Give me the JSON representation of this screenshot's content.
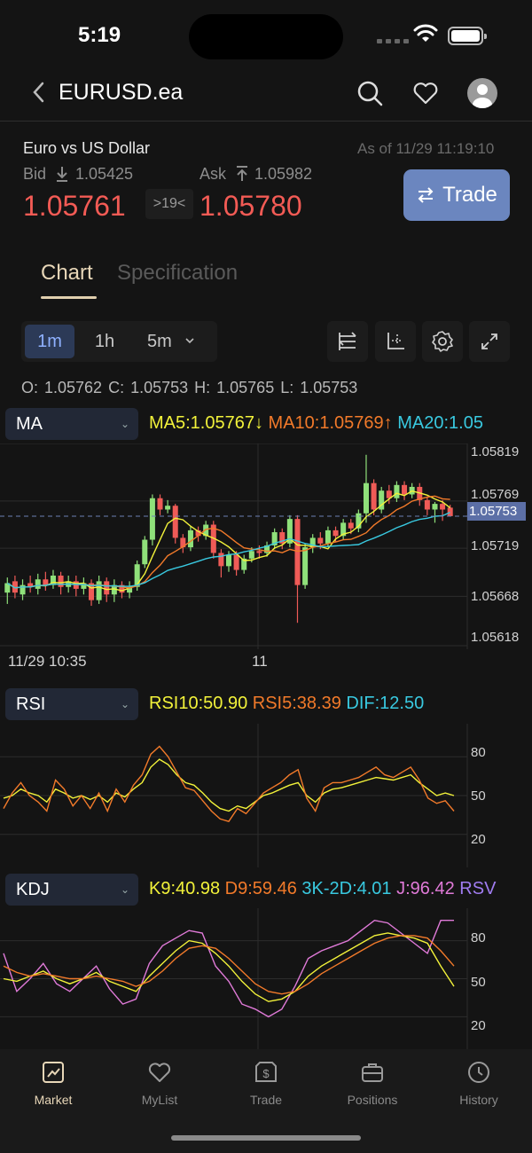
{
  "status": {
    "time": "5:19"
  },
  "header": {
    "symbol": "EURUSD.ea"
  },
  "quote": {
    "name": "Euro vs US Dollar",
    "as_of": "As of 11/29 11:19:10",
    "bid_label": "Bid",
    "bid_low": "1.05425",
    "ask_label": "Ask",
    "ask_high": "1.05982",
    "bid_price": "1.05761",
    "spread": ">19<",
    "ask_price": "1.05780",
    "trade_button": "Trade"
  },
  "tabs": [
    "Chart",
    "Specification"
  ],
  "intervals": [
    "1m",
    "1h",
    "5m"
  ],
  "ohlc": "O: 1.05762  C: 1.05753  H: 1.05765  L: 1.05753",
  "ma": {
    "selector": "MA",
    "ma5": "MA5:1.05767↓",
    "ma10": "MA10:1.05769↑",
    "ma20": "MA20:1.05",
    "colors": {
      "ma5": "#f2f23a",
      "ma10": "#f27a2a",
      "ma20": "#39c9e0"
    }
  },
  "price_axis": [
    "1.05819",
    "1.05769",
    "1.05719",
    "1.05668",
    "1.05618"
  ],
  "current_price": "1.05753",
  "time_axis": [
    "11/29 10:35",
    "11"
  ],
  "rsi": {
    "selector": "RSI",
    "rsi10": "RSI10:50.90",
    "rsi5": "RSI5:38.39",
    "dif": "DIF:12.50",
    "axis": [
      "80",
      "50",
      "20"
    ]
  },
  "kdj": {
    "selector": "KDJ",
    "k": "K9:40.98",
    "d": "D9:59.46",
    "diff": "3K-2D:4.01",
    "j": "J:96.42",
    "rsv": "RSV",
    "axis": [
      "80",
      "50",
      "20"
    ]
  },
  "nav": [
    {
      "label": "Market",
      "icon": "chart-trend-icon",
      "active": true
    },
    {
      "label": "MyList",
      "icon": "heart-icon",
      "active": false
    },
    {
      "label": "Trade",
      "icon": "dollar-swap-icon",
      "active": false
    },
    {
      "label": "Positions",
      "icon": "briefcase-icon",
      "active": false
    },
    {
      "label": "History",
      "icon": "clock-history-icon",
      "active": false
    }
  ],
  "chart_data": {
    "type": "candlestick",
    "x_labels": [
      "11/29 10:35",
      "11"
    ],
    "y_ticks": [
      1.05819,
      1.05769,
      1.05719,
      1.05668,
      1.05618
    ],
    "last": 1.05753,
    "candles": [
      [
        1.05672,
        1.05682,
        1.0566,
        1.05688
      ],
      [
        1.05684,
        1.05672,
        1.05666,
        1.0569
      ],
      [
        1.0567,
        1.0568,
        1.05664,
        1.05686
      ],
      [
        1.05682,
        1.05678,
        1.05672,
        1.0569
      ],
      [
        1.05676,
        1.05686,
        1.0567,
        1.05692
      ],
      [
        1.05686,
        1.0568,
        1.05674,
        1.05694
      ],
      [
        1.0568,
        1.0569,
        1.05676,
        1.05696
      ],
      [
        1.0569,
        1.05678,
        1.0567,
        1.05694
      ],
      [
        1.05678,
        1.05684,
        1.05672,
        1.0569
      ],
      [
        1.05684,
        1.05676,
        1.05668,
        1.0569
      ],
      [
        1.05676,
        1.05682,
        1.0567,
        1.05688
      ],
      [
        1.05682,
        1.05664,
        1.05658,
        1.05686
      ],
      [
        1.05664,
        1.05684,
        1.0566,
        1.0569
      ],
      [
        1.05684,
        1.0567,
        1.05662,
        1.05688
      ],
      [
        1.0567,
        1.0568,
        1.05662,
        1.05686
      ],
      [
        1.0568,
        1.05672,
        1.05666,
        1.05684
      ],
      [
        1.05672,
        1.05678,
        1.05666,
        1.05684
      ],
      [
        1.05678,
        1.05702,
        1.05674,
        1.05706
      ],
      [
        1.05702,
        1.05728,
        1.05698,
        1.05732
      ],
      [
        1.05728,
        1.05772,
        1.05722,
        1.05776
      ],
      [
        1.05772,
        1.0576,
        1.05754,
        1.05776
      ],
      [
        1.0576,
        1.05764,
        1.05756,
        1.0577
      ],
      [
        1.05764,
        1.0573,
        1.05724,
        1.05766
      ],
      [
        1.0573,
        1.0572,
        1.05714,
        1.05734
      ],
      [
        1.0572,
        1.05738,
        1.05716,
        1.05742
      ],
      [
        1.05738,
        1.05732,
        1.05726,
        1.05742
      ],
      [
        1.05732,
        1.05744,
        1.05728,
        1.05748
      ],
      [
        1.05744,
        1.05714,
        1.05708,
        1.05748
      ],
      [
        1.05714,
        1.057,
        1.05688,
        1.05718
      ],
      [
        1.057,
        1.05712,
        1.05694,
        1.05716
      ],
      [
        1.05712,
        1.05696,
        1.0569,
        1.05716
      ],
      [
        1.05696,
        1.05708,
        1.05692,
        1.05712
      ],
      [
        1.05708,
        1.05716,
        1.05704,
        1.0572
      ],
      [
        1.05716,
        1.05714,
        1.05708,
        1.05722
      ],
      [
        1.05714,
        1.05722,
        1.0571,
        1.05726
      ],
      [
        1.05722,
        1.05736,
        1.05718,
        1.0574
      ],
      [
        1.05736,
        1.05724,
        1.05718,
        1.0574
      ],
      [
        1.05724,
        1.0575,
        1.0572,
        1.05754
      ],
      [
        1.0575,
        1.0568,
        1.0564,
        1.05754
      ],
      [
        1.0568,
        1.0572,
        1.05676,
        1.05724
      ],
      [
        1.0572,
        1.0573,
        1.05714,
        1.05734
      ],
      [
        1.0573,
        1.05724,
        1.05718,
        1.05736
      ],
      [
        1.05724,
        1.05738,
        1.0572,
        1.05742
      ],
      [
        1.05738,
        1.05732,
        1.05726,
        1.05742
      ],
      [
        1.05732,
        1.05746,
        1.05728,
        1.0575
      ],
      [
        1.05746,
        1.0574,
        1.05734,
        1.0575
      ],
      [
        1.0574,
        1.05756,
        1.05736,
        1.0576
      ],
      [
        1.05756,
        1.05788,
        1.05746,
        1.05818
      ],
      [
        1.05788,
        1.0576,
        1.05754,
        1.05792
      ],
      [
        1.0576,
        1.0578,
        1.05756,
        1.05784
      ],
      [
        1.0578,
        1.05772,
        1.05766,
        1.05786
      ],
      [
        1.05772,
        1.05786,
        1.05768,
        1.0579
      ],
      [
        1.05786,
        1.05776,
        1.0577,
        1.0579
      ],
      [
        1.05776,
        1.05784,
        1.05772,
        1.05788
      ],
      [
        1.05784,
        1.0577,
        1.05764,
        1.05788
      ],
      [
        1.0577,
        1.0576,
        1.05754,
        1.05774
      ],
      [
        1.0576,
        1.05766,
        1.05746,
        1.05768
      ],
      [
        1.05766,
        1.0576,
        1.05748,
        1.0577
      ],
      [
        1.05762,
        1.05753,
        1.05753,
        1.05765
      ]
    ]
  }
}
